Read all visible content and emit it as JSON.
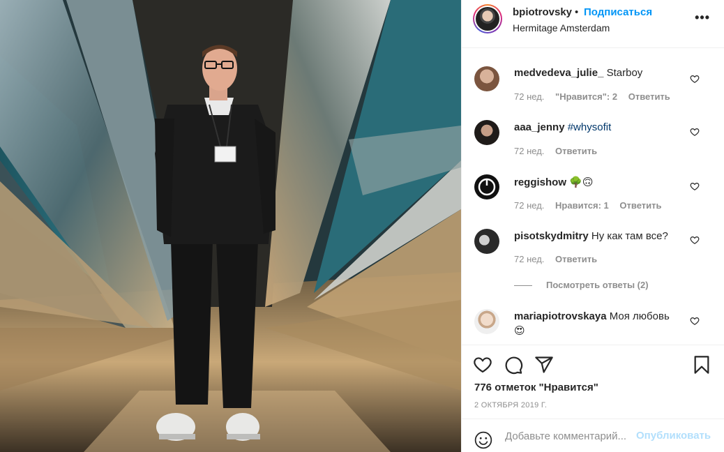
{
  "post": {
    "username": "bpiotrovsky",
    "separator": "•",
    "follow_label": "Подписаться",
    "location": "Hermitage Amsterdam",
    "more_label": "•••"
  },
  "comments": [
    {
      "username": "medvedeva_julie_",
      "text": "Starboy",
      "time": "72 нед.",
      "likes": "\"Нравится\": 2",
      "reply": "Ответить",
      "avatar_color": "#a47a62"
    },
    {
      "username": "aaa_jenny",
      "text": "#whysofit",
      "time": "72 нед.",
      "likes": "",
      "reply": "Ответить",
      "avatar_color": "#2e2a28"
    },
    {
      "username": "reggishow",
      "text": "🌳🙃",
      "time": "72 нед.",
      "likes": "Нравится: 1",
      "reply": "Ответить",
      "avatar_color": "#111111"
    },
    {
      "username": "pisotskydmitry",
      "text": "Ну как там все?",
      "time": "72 нед.",
      "likes": "",
      "reply": "Ответить",
      "avatar_color": "#3d3d3d"
    },
    {
      "username": "mariapiotrovskaya",
      "text": "Моя любовь",
      "emoji": "😍",
      "avatar_color": "#d9c4b2"
    }
  ],
  "view_replies": "Посмотреть ответы (2)",
  "actions": {
    "like_icon": "heart-icon",
    "comment_icon": "comment-icon",
    "share_icon": "share-icon",
    "save_icon": "bookmark-icon"
  },
  "likes_count": "776 отметок \"Нравится\"",
  "date": "2 ОКТЯБРЯ 2019 Г.",
  "add_comment": {
    "placeholder": "Добавьте комментарий...",
    "publish_label": "Опубликовать"
  },
  "colors": {
    "link_blue": "#0095f6",
    "publish_disabled": "#b2dffc",
    "muted": "#8e8e8e",
    "hashtag": "#00376b"
  }
}
